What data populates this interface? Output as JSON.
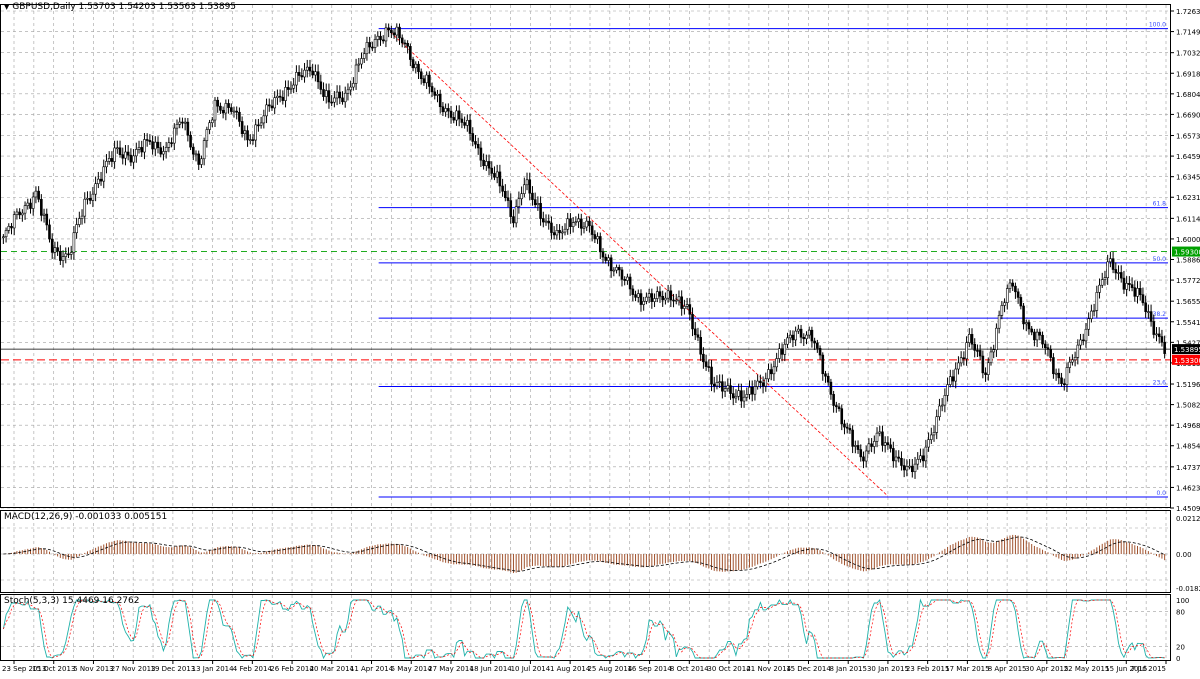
{
  "chart": {
    "symbol_line": "GBPUSD,Daily 1.53703 1.54203 1.53563 1.53895",
    "menu_arrow": "▼"
  },
  "macd": {
    "label": "MACD(12,26,9) -0.001033 0.005151",
    "axis_ticks": [
      "0.021283",
      "0.00",
      "-0.01825"
    ]
  },
  "stoch": {
    "label": "Stoch(5,3,3) 15.4469 16.2762",
    "axis_ticks": [
      "100",
      "80",
      "20",
      "0"
    ]
  },
  "price_axis_ticks": [
    "1.72630",
    "1.71490",
    "1.70320",
    "1.69180",
    "1.68040",
    "1.66900",
    "1.65730",
    "1.64590",
    "1.63450",
    "1.62310",
    "1.61140",
    "1.60000",
    "1.58860",
    "1.57720",
    "1.56550",
    "1.55410",
    "1.54270",
    "1.53130",
    "1.51960",
    "1.50820",
    "1.49680",
    "1.48540",
    "1.47370",
    "1.46230",
    "1.45090"
  ],
  "price_tags": {
    "green": "1.59300",
    "current": "1.53895",
    "red": "1.53300"
  },
  "fib_labels": [
    "100.0",
    "61.8",
    "50.0",
    "38.2",
    "23.6",
    "0.0"
  ],
  "date_labels": [
    "23 Sep 2013",
    "15 Oct 2013",
    "5 Nov 2013",
    "27 Nov 2013",
    "19 Dec 2013",
    "13 Jan 2014",
    "4 Feb 2014",
    "26 Feb 2014",
    "20 Mar 2014",
    "11 Apr 2014",
    "5 May 2014",
    "27 May 2014",
    "18 Jun 2014",
    "10 Jul 2014",
    "1 Aug 2014",
    "25 Aug 2014",
    "16 Sep 2014",
    "8 Oct 2014",
    "30 Oct 2014",
    "21 Nov 2014",
    "15 Dec 2014",
    "8 Jan 2015",
    "30 Jan 2015",
    "23 Feb 2015",
    "17 Mar 2015",
    "8 Apr 2015",
    "30 Apr 2015",
    "22 May 2015",
    "15 Jun 2015",
    "7 Jul 2015"
  ],
  "colors": {
    "grid": "#a0a0a0",
    "candle": "#000000",
    "fib_line": "#0000ff",
    "fib_label": "#3a4fff",
    "trend_line": "#ff0000",
    "green_level": "#00a000",
    "red_level": "#ff0000",
    "histogram": "#a0522d",
    "signal": "#000000",
    "stoch_main": "#20b2aa",
    "stoch_signal": "#ff0000"
  }
}
